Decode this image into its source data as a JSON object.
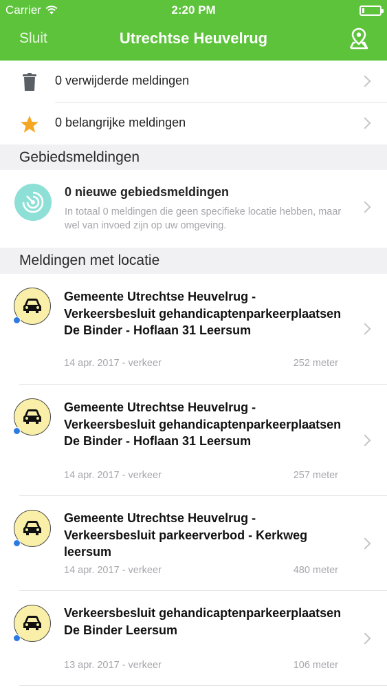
{
  "status_bar": {
    "carrier": "Carrier",
    "time": "2:20 PM"
  },
  "nav": {
    "close_label": "Sluit",
    "title": "Utrechtse Heuvelrug",
    "map_icon": "map-pin-icon"
  },
  "top_rows": [
    {
      "icon": "trash-icon",
      "label": "0 verwijderde meldingen"
    },
    {
      "icon": "star-icon",
      "label": "0 belangrijke meldingen"
    }
  ],
  "sections": {
    "area": "Gebiedsmeldingen",
    "location": "Meldingen met locatie"
  },
  "area_notifications": {
    "title": "0 nieuwe gebiedsmeldingen",
    "description": "In totaal 0 meldingen die geen specifieke locatie hebben, maar wel van invoed zijn op uw omgeving."
  },
  "notifications": [
    {
      "title": "Gemeente Utrechtse Heuvelrug - Verkeersbesluit gehandicaptenparkeerplaatsen De Binder - Hoflaan 31 Leersum",
      "date": "14 apr. 2017 - verkeer",
      "distance": "252 meter"
    },
    {
      "title": "Gemeente Utrechtse Heuvelrug - Verkeersbesluit gehandicaptenparkeerplaatsen De Binder - Hoflaan 31 Leersum",
      "date": "14 apr. 2017 - verkeer",
      "distance": "257 meter"
    },
    {
      "title": "Gemeente Utrechtse Heuvelrug - Verkeersbesluit parkeerverbod - Kerkweg leersum",
      "date": "14 apr. 2017 - verkeer",
      "distance": "480 meter"
    },
    {
      "title": "Verkeersbesluit gehandicaptenparkeerplaatsen De Binder Leersum",
      "date": "13 apr. 2017 - verkeer",
      "distance": "106 meter"
    }
  ],
  "colors": {
    "accent": "#5cc33a",
    "unread_dot": "#2d7be0",
    "car_badge": "#f9efa8",
    "area_badge": "#8ee0d6",
    "star": "#f5a623"
  }
}
